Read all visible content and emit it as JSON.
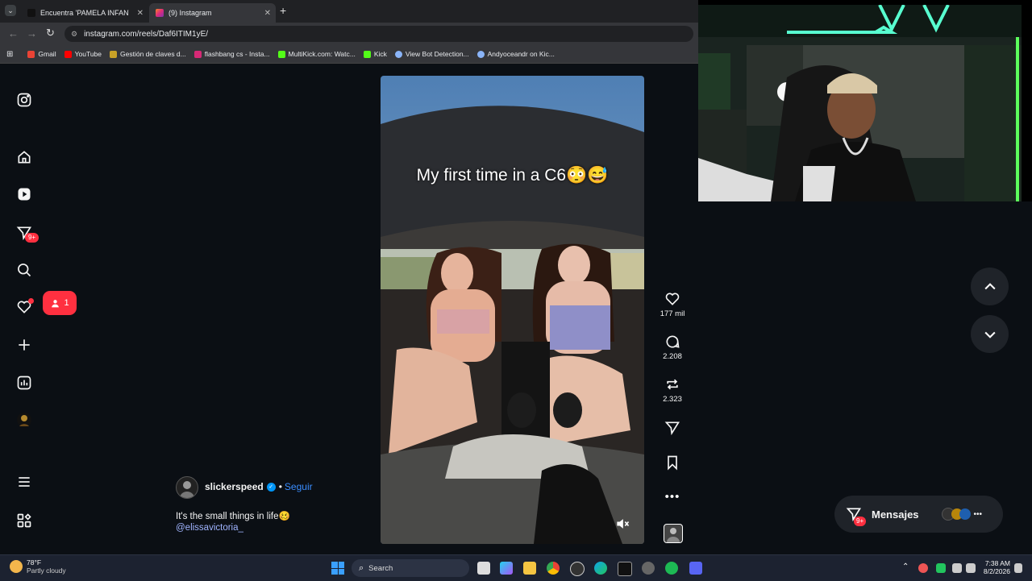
{
  "browser": {
    "tabs": [
      {
        "title": "Encuentra 'PAMELA INFANTE' e",
        "active": false
      },
      {
        "title": "(9) Instagram",
        "active": true
      }
    ],
    "url": "instagram.com/reels/Daf6ITIM1yE/",
    "bookmarks": [
      "Gmail",
      "YouTube",
      "Gestión de claves d...",
      "flashbang cs - Insta...",
      "MultiKick.com: Watc...",
      "Kick",
      "View Bot Detection...",
      "Andyoceandr on Kic..."
    ]
  },
  "sidebar": {
    "messages_badge": "9+",
    "notification_popup_count": "1"
  },
  "reel": {
    "overlay_text": "My first time in a C6😳😅",
    "username": "slickerspeed",
    "follow_label": "Seguir",
    "caption": "It's the small things in life🥴",
    "mention": "@elissavictoria_",
    "likes": "177 mil",
    "comments": "2.208",
    "reposts": "2.323"
  },
  "messages_pill": {
    "label": "Mensajes",
    "badge": "9+"
  },
  "taskbar": {
    "weather_temp": "78°F",
    "weather_desc": "Partly cloudy",
    "search_placeholder": "Search",
    "time": "7:38 AM",
    "date": "8/2/2026"
  },
  "colors": {
    "accent_red": "#ff3040",
    "verified_blue": "#0095f6",
    "follow_blue": "#3a8dff"
  }
}
